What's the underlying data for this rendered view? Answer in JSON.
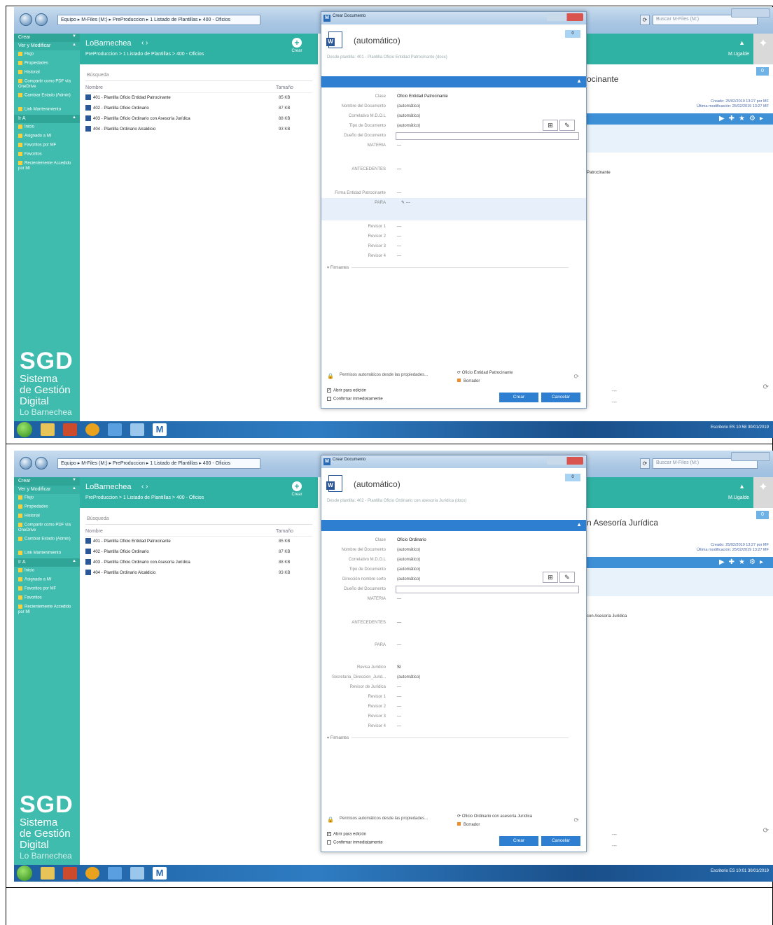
{
  "window": {
    "breadcrumb": "Equipo ▸ M-Files (M:) ▸ PreProduccion ▸ 1 Listado de Plantillas ▸ 400 - Oficios",
    "search_placeholder": "Buscar M-Files (M:)"
  },
  "sidebar": {
    "crear": "Crear",
    "ver_modificar": "Ver y Modificar",
    "items": [
      "Flujo",
      "Propiedades",
      "Historial",
      "Compartir como PDF vía OneDrive",
      "Cambiar Estado (Admin)",
      "Link Mantenimiento"
    ],
    "va": "Ir A",
    "nav_items": [
      "Inicio",
      "Asignado a Mí",
      "Favoritos por MF",
      "Favoritos",
      "Recientemente Accedido por Mí"
    ],
    "sgd_big": "SGD",
    "sgd_line1": "Sistema",
    "sgd_line2": "de Gestión",
    "sgd_line3": "Digital",
    "sgd_line4": "Lo Barnechea"
  },
  "center": {
    "logo": "LoBarnechea",
    "breadcrumb": "PreProduccion > 1 Listado de Plantillas > 400 - Oficios",
    "crear": "Crear",
    "search_placeholder": "Búsqueda",
    "col_name": "Nombre",
    "col_size": "Tamaño",
    "files": [
      {
        "name": "401 - Plantilla Oficio Entidad Patrocinante",
        "size": "85 KB"
      },
      {
        "name": "402 - Plantilla Oficio Ordinario",
        "size": "87 KB"
      },
      {
        "name": "403 - Plantilla Oficio Ordinario con Asesoría Jurídica",
        "size": "88 KB"
      },
      {
        "name": "404 - Plantilla Ordinario Alcaldicio",
        "size": "93 KB"
      }
    ]
  },
  "right": {
    "user": "M.Ugalde",
    "num": "0",
    "title_1": "ocinante",
    "title_2": "n Asesoría Jurídica",
    "side_text_1": "Patrocinante",
    "side_text_2": "con Asesoría Jurídica",
    "created": "Creado: 25/02/2019 13:27 por MF",
    "modified": "Última modificación: 25/02/2019 13:27 MF",
    "dash": "---"
  },
  "taskbar": {
    "tray_1": "Escritorio  ES  10:58  30/01/2019",
    "tray_2": "Escritorio  ES  10:01  30/01/2019"
  },
  "dialog": {
    "title": "Crear Documento",
    "auto": "(automático)",
    "version": "0",
    "desde_1": "Desde plantilla: 401 - Plantilla Oficio Entidad Patrocinante (docx)",
    "desde_2": "Desde plantilla: 402 - Plantilla Oficio Ordinario con asesoría Jurídica (docx)",
    "clase_label": "Clase",
    "clase_1": "Oficio Entidad Patrocinante",
    "clase_2": "Oficio Ordinario",
    "nombre_label": "Nombre del Documento",
    "correlativo_label": "Correlativo M.D.O.L",
    "tipo_label": "Tipo de Documento",
    "direccion_label": "Dirección nombre corto",
    "duenio_label": "Dueño del Documento",
    "materia_label": "MATERIA",
    "antecedentes_label": "ANTECEDENTES",
    "firma_label": "Firma Entidad Patrocinante",
    "para_label": "PARA",
    "revisor1": "Revisor 1",
    "revisor2": "Revisor 2",
    "revisor3": "Revisor 3",
    "revisor4": "Revisor 4",
    "revisa_label": "Revisa Jurídico",
    "revisa_val": "Sí",
    "secretaria_label": "Secretaria_Direccion_Jurid...",
    "revisor_juridico_label": "Revisor de Jurídica",
    "automatico": "(automático)",
    "dash": "---",
    "firmantes": "Firmantes",
    "permisos": "Permisos automáticos desde las propiedades...",
    "workflow_1": "Oficio Entidad Patrocinante",
    "workflow_2": "Oficio Ordinario con asesoría Jurídica",
    "estado": "Borrador",
    "abrir": "Abrir para edición",
    "confirmar": "Confirmar inmediatamente",
    "crear": "Crear",
    "cancelar": "Cancelar"
  }
}
